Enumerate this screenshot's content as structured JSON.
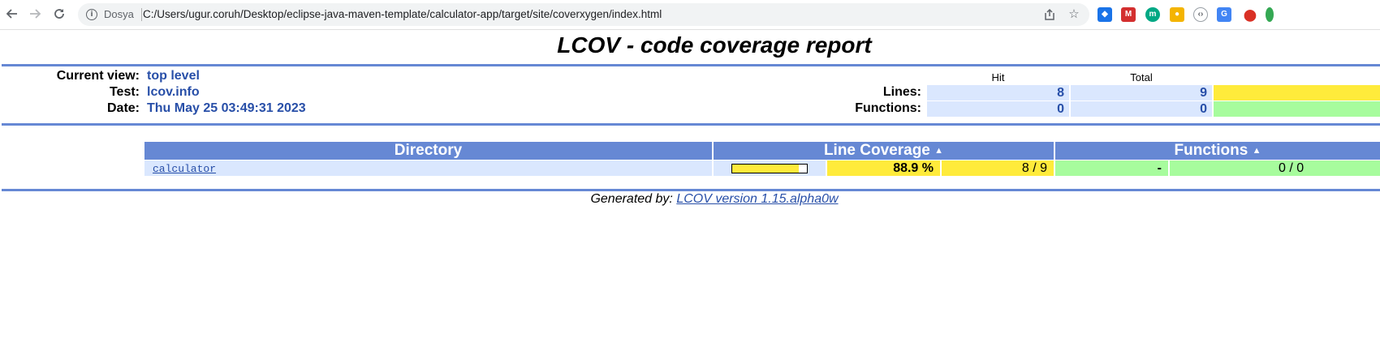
{
  "browser": {
    "scheme_label": "Dosya",
    "url": "C:/Users/ugur.coruh/Desktop/eclipse-java-maven-template/calculator-app/target/site/coverxygen/index.html"
  },
  "report": {
    "title": "LCOV - code coverage report",
    "header": {
      "current_view_label": "Current view:",
      "current_view_value": "top level",
      "test_label": "Test:",
      "test_value": "lcov.info",
      "date_label": "Date:",
      "date_value": "Thu May 25 03:49:31 2023",
      "hit_label": "Hit",
      "total_label": "Total",
      "lines_label": "Lines:",
      "lines_hit": "8",
      "lines_total": "9",
      "functions_label": "Functions:",
      "functions_hit": "0",
      "functions_total": "0"
    },
    "table": {
      "col_directory": "Directory",
      "col_line_coverage": "Line Coverage",
      "col_functions": "Functions",
      "rows": [
        {
          "name": "calculator",
          "line_percent": "88.9 %",
          "line_fraction": 0.889,
          "line_ratio": "8 / 9",
          "func_percent": "-",
          "func_ratio": "0 / 0"
        }
      ]
    },
    "footer": {
      "prefix": "Generated by:",
      "link_text": "LCOV version 1.15.alpha0w"
    }
  },
  "colors": {
    "header_blue": "#6688d4",
    "value_blue": "#284fa8",
    "cell_bg": "#dae7fe",
    "coverage_medium": "#ffeb3b",
    "coverage_high": "#a7fc9d"
  }
}
